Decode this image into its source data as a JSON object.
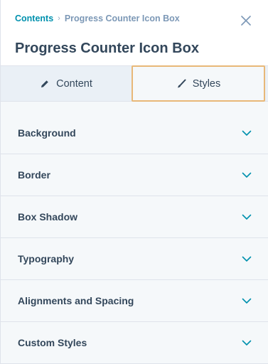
{
  "header": {
    "breadcrumb_root": "Contents",
    "breadcrumb_current": "Progress Counter Icon Box",
    "title": "Progress Counter Icon Box"
  },
  "tabs": [
    {
      "label": "Content",
      "icon": "pencil-icon",
      "active": false
    },
    {
      "label": "Styles",
      "icon": "brush-icon",
      "active": true
    }
  ],
  "sections": [
    {
      "label": "Background"
    },
    {
      "label": "Border"
    },
    {
      "label": "Box Shadow"
    },
    {
      "label": "Typography"
    },
    {
      "label": "Alignments and Spacing"
    },
    {
      "label": "Custom Styles"
    }
  ],
  "colors": {
    "accent": "#0091ae",
    "text": "#33475b",
    "active_tab_outline": "#e8b878"
  }
}
